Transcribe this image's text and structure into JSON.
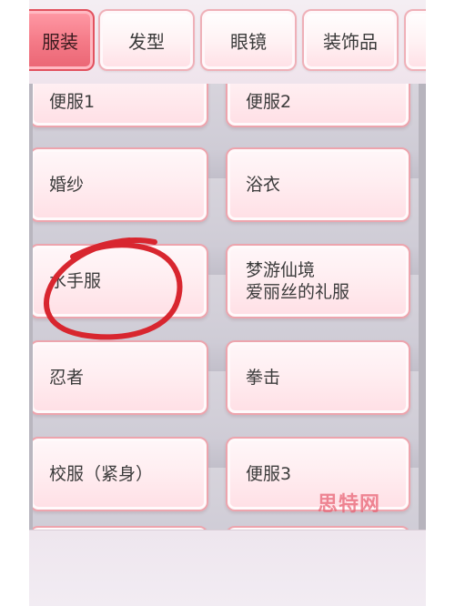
{
  "tabs": [
    {
      "label": "服装",
      "active": true
    },
    {
      "label": "发型",
      "active": false
    },
    {
      "label": "眼镜",
      "active": false
    },
    {
      "label": "装饰品",
      "active": false
    }
  ],
  "items": [
    {
      "label": "便服1"
    },
    {
      "label": "便服2"
    },
    {
      "label": "婚纱"
    },
    {
      "label": "浴衣"
    },
    {
      "label": "水手服"
    },
    {
      "label": "梦游仙境\n爱丽丝的礼服"
    },
    {
      "label": "忍者"
    },
    {
      "label": "拳击"
    },
    {
      "label": "校服（紧身）"
    },
    {
      "label": "便服3"
    }
  ],
  "watermark": "思特网",
  "annotation": {
    "shape": "hand-drawn circle",
    "color": "#d8262f",
    "target": "水手服"
  },
  "colors": {
    "active_tab": "#f47986",
    "card_fill": "#ffeef1",
    "card_border": "#eda4ad",
    "annotation": "#d8262f"
  }
}
